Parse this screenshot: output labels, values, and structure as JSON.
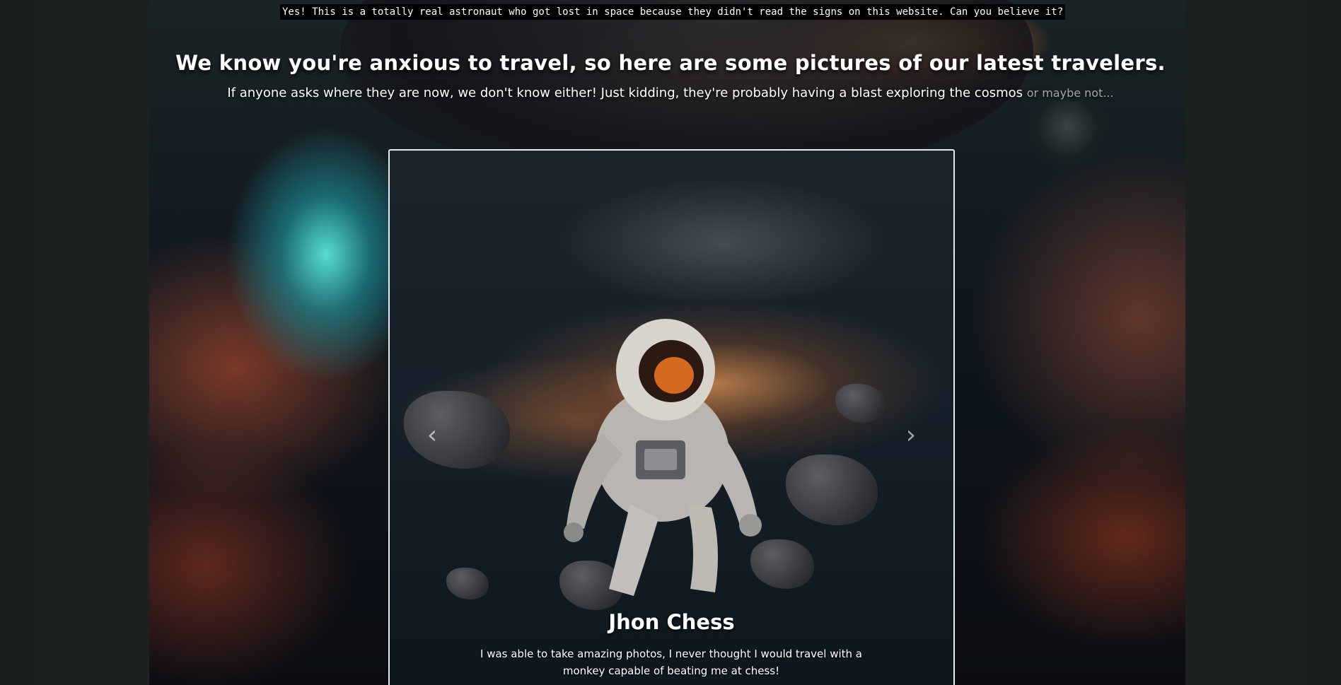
{
  "banner": {
    "caption": "Yes! This is a totally real astronaut who got lost in space because they didn't read the signs on this website. Can you believe it?"
  },
  "hero": {
    "headline": "We know you're anxious to travel, so here are some pictures of our latest travelers.",
    "subline": "If anyone asks where they are now, we don't know either! Just kidding, they're probably having a blast exploring the cosmos",
    "subline_muted": "or maybe not..."
  },
  "carousel": {
    "prev_icon": "chevron-left-icon",
    "next_icon": "chevron-right-icon",
    "slide": {
      "title": "Jhon Chess",
      "text": "I was able to take amazing photos, I never thought I would travel with a monkey capable of beating me at chess!"
    }
  },
  "colors": {
    "page_bg": "#1c201f",
    "frame_border": "#e8ecec",
    "muted_text": "#a3a7a8"
  }
}
